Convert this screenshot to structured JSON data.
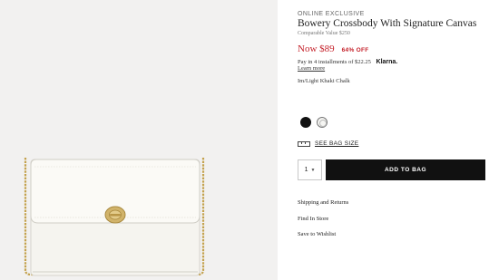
{
  "product": {
    "tag": "ONLINE EXCLUSIVE",
    "title": "Bowery Crossbody With Signature Canvas",
    "comparable": "Comparable Value $250",
    "price": "Now  $89",
    "discount": "64% OFF",
    "installments": "Pay in 4 installments of $22.25",
    "klarna_label": "Klarna.",
    "learn_more": "Learn more",
    "color_name": "Im/Light Khaki Chalk",
    "swatches": [
      {
        "name": "black",
        "color": "#111111"
      },
      {
        "name": "chalk",
        "color": "#f6f6f3"
      }
    ]
  },
  "actions": {
    "size_guide": "SEE BAG SIZE",
    "quantity": "1",
    "add_to_bag": "ADD TO BAG"
  },
  "links": {
    "shipping": "Shipping and Returns",
    "find_store": "Find In Store",
    "wishlist": "Save to Wishlist"
  },
  "colors": {
    "price_red": "#c41f28",
    "button_black": "#111111",
    "image_bg": "#f2f1f0"
  }
}
